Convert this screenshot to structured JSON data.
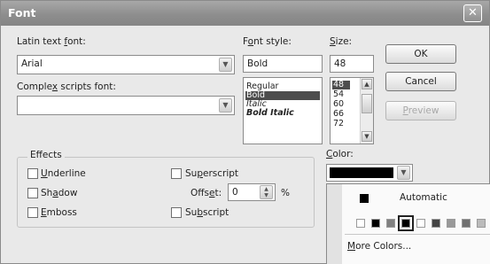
{
  "window": {
    "title": "Font",
    "close_label": "✕"
  },
  "latin_font": {
    "label_before": "Latin text ",
    "label_accel": "f",
    "label_after": "ont:",
    "value": "Arial"
  },
  "complex_font": {
    "label_before": "Comple",
    "label_accel": "x",
    "label_after": " scripts font:",
    "value": ""
  },
  "font_style": {
    "label_before": "F",
    "label_accel": "o",
    "label_after": "nt style:",
    "value": "Bold",
    "options": [
      "Regular",
      "Bold",
      "Italic",
      "Bold Italic"
    ],
    "selected": "Bold"
  },
  "size": {
    "label_accel": "S",
    "label_after": "ize:",
    "value": "48",
    "options": [
      "48",
      "54",
      "60",
      "66",
      "72"
    ],
    "selected": "48"
  },
  "buttons": {
    "ok": "OK",
    "cancel": "Cancel",
    "preview_accel": "P",
    "preview_after": "review"
  },
  "effects": {
    "title": "Effects",
    "underline": {
      "accel": "U",
      "after": "nderline",
      "checked": false
    },
    "shadow": {
      "before": "Sh",
      "accel": "a",
      "after": "dow",
      "checked": false
    },
    "emboss": {
      "accel": "E",
      "after": "mboss",
      "checked": false
    },
    "superscript": {
      "before": "Su",
      "accel": "p",
      "after": "erscript",
      "checked": false
    },
    "offset": {
      "before": "Offs",
      "accel": "e",
      "after": "t:",
      "value": "0",
      "unit": "%"
    },
    "subscript": {
      "before": "Su",
      "accel": "b",
      "after": "script",
      "checked": false
    }
  },
  "color": {
    "label_accel": "C",
    "label_after": "olor:",
    "value_hex": "#000000",
    "menu": {
      "automatic_label": "Automatic",
      "swatches": [
        "#ffffff",
        "#000000",
        "#808080",
        "#000000",
        "#ffffff",
        "#444444",
        "#999999",
        "#707070",
        "#bbbbbb"
      ],
      "selected_index": 3,
      "more_accel": "M",
      "more_after": "ore Colors..."
    }
  }
}
